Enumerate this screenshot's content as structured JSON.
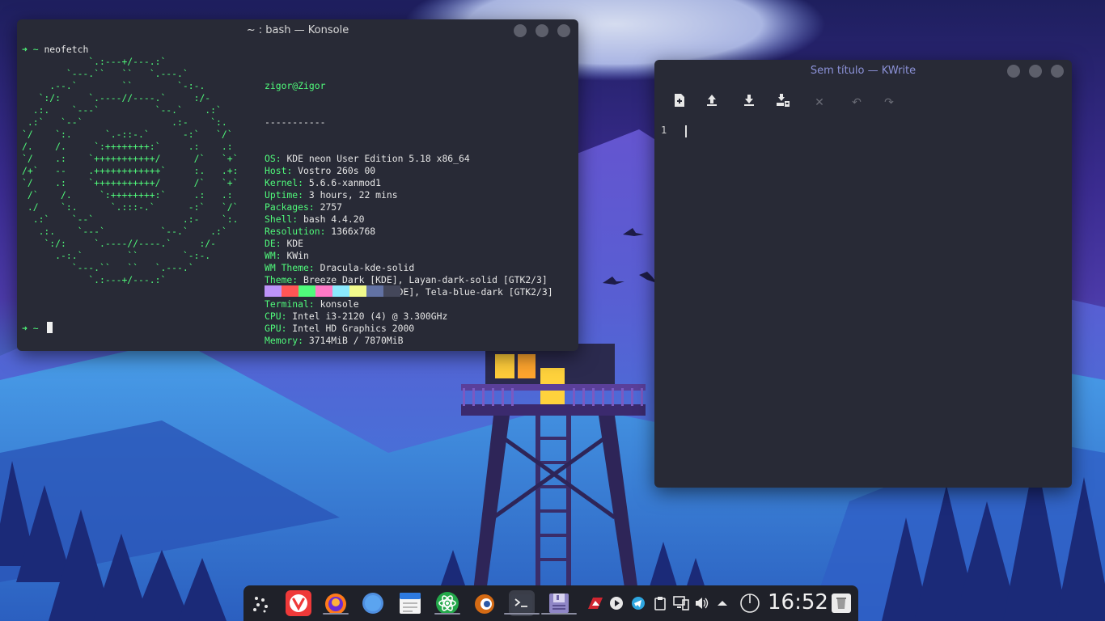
{
  "konsole": {
    "title": "~ : bash — Konsole",
    "command_prompt": "➜ ~ ",
    "command": "neofetch",
    "ascii_art": "            `.:---+/---.:`\n        `---.``   ``   `.---.`\n     .--.`        ``        `-:-.\n   `:/:     `.----//----.`     :/-\n  .:.    `---`          `--.`    .:`\n .:`   `--`                .:-    `:.\n`/    `:.      `.-::-.`      -:`   `/`\n/.    /.     `:++++++++:`     .:    .:\n`/    .:    `+++++++++++/      /`   `+`\n/+`   --    .++++++++++++`     :.   .+:\n`/    .:    `+++++++++++/      /`   `+`\n /`    /.     `:++++++++:`     .:   .:\n ./    `:.      `.:::-.`      -:`   `/`\n  .:`    `--`                .:-    `:.\n   .:.    `---`          `--.`    .:`\n    `:/:     `.----//----.`     :/-\n      .-:.`        ``        `-:-.\n         `---.``   ``   `.---.`\n            `.:---+/---.:`",
    "info": {
      "user_host": "zigor@Zigor",
      "separator": "-----------",
      "lines": [
        {
          "key": "OS",
          "value": "KDE neon User Edition 5.18 x86_64"
        },
        {
          "key": "Host",
          "value": "Vostro 260s 00"
        },
        {
          "key": "Kernel",
          "value": "5.6.6-xanmod1"
        },
        {
          "key": "Uptime",
          "value": "3 hours, 22 mins"
        },
        {
          "key": "Packages",
          "value": "2757"
        },
        {
          "key": "Shell",
          "value": "bash 4.4.20"
        },
        {
          "key": "Resolution",
          "value": "1366x768"
        },
        {
          "key": "DE",
          "value": "KDE"
        },
        {
          "key": "WM",
          "value": "KWin"
        },
        {
          "key": "WM Theme",
          "value": "Dracula-kde-solid"
        },
        {
          "key": "Theme",
          "value": "Breeze Dark [KDE], Layan-dark-solid [GTK2/3]"
        },
        {
          "key": "Icons",
          "value": "Tela-blue-dark [KDE], Tela-blue-dark [GTK2/3]"
        },
        {
          "key": "Terminal",
          "value": "konsole"
        },
        {
          "key": "CPU",
          "value": "Intel i3-2120 (4) @ 3.300GHz"
        },
        {
          "key": "GPU",
          "value": "Intel HD Graphics 2000"
        },
        {
          "key": "Memory",
          "value": "3714MiB / 7870MiB"
        }
      ]
    },
    "palette": [
      "#bd93f9",
      "#ff5555",
      "#50fa7b",
      "#ff79c6",
      "#8be9fd",
      "#f1fa8c",
      "#6272a4",
      "#44475a"
    ],
    "second_prompt": "➜ ~ "
  },
  "kwrite": {
    "title": "Sem título — KWrite",
    "line_number": "1",
    "toolbar": [
      "new-document-icon",
      "open-icon",
      "save-icon",
      "save-as-icon",
      "close-icon",
      "undo-icon",
      "redo-icon"
    ]
  },
  "panel": {
    "clock": "16:52",
    "launchers": [
      "application-launcher",
      "vivaldi",
      "firefox",
      "dolphin",
      "notes",
      "atom",
      "blender",
      "konsole",
      "kwrite"
    ],
    "tray": [
      "screencast",
      "media-player",
      "telegram",
      "clipboard",
      "network",
      "volume",
      "expand-tray"
    ]
  }
}
